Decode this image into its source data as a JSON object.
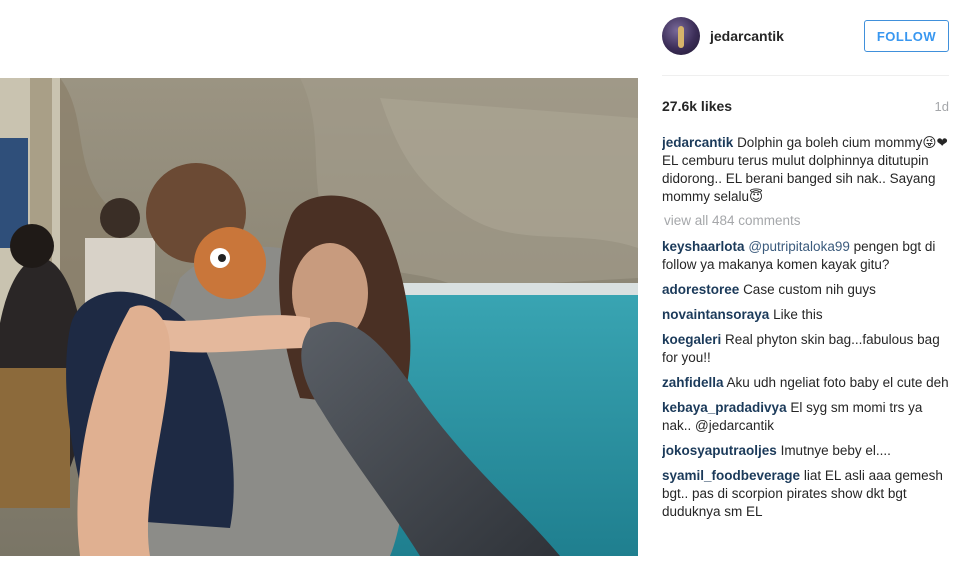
{
  "post": {
    "username": "jedarcantik",
    "follow_label": "FOLLOW",
    "likes": "27.6k likes",
    "time": "1d",
    "caption_author": "jedarcantik",
    "caption_text": "Dolphin ga boleh cium mommy😜❤ EL cemburu terus mulut dolphinnya ditutupin didorong.. EL berani banged sih nak.. Sayang mommy selalu😇",
    "view_all": "view all 484 comments"
  },
  "comments": [
    {
      "author": "keyshaarlota",
      "mention": "@putripitaloka99",
      "text": " pengen bgt di follow ya makanya komen kayak gitu?"
    },
    {
      "author": "adorestoree",
      "mention": "",
      "text": "Case custom nih guys"
    },
    {
      "author": "novaintansoraya",
      "mention": "",
      "text": "Like this"
    },
    {
      "author": "koegaleri",
      "mention": "",
      "text": "Real phyton skin bag...fabulous bag for you!!"
    },
    {
      "author": "zahfidella",
      "mention": "",
      "text": "Aku udh ngeliat foto baby el cute deh"
    },
    {
      "author": "kebaya_pradadivya",
      "mention": "",
      "text": "El syg sm momi trs ya nak.. @jedarcantik"
    },
    {
      "author": "jokosyaputraoljes",
      "mention": "",
      "text": "Imutnye beby el...."
    },
    {
      "author": "syamil_foodbeverage",
      "mention": "",
      "text": "liat EL asli aaa gemesh bgt.. pas di scorpion pirates show dkt bgt duduknya sm EL"
    }
  ],
  "colors": {
    "follow_blue": "#3897f0",
    "author_text": "#1b3a5a",
    "muted": "#a5a7aa"
  }
}
